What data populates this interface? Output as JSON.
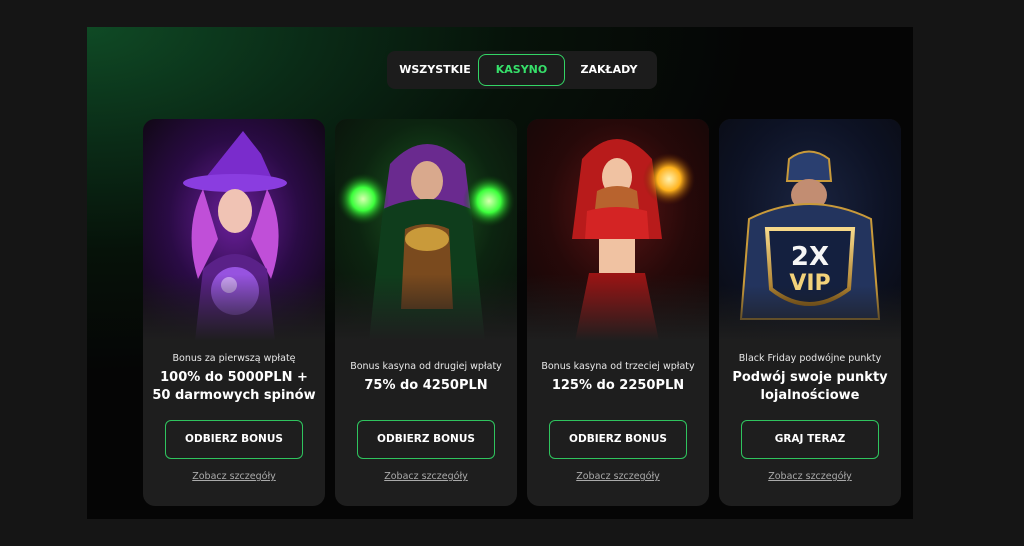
{
  "tabs": [
    {
      "label": "WSZYSTKIE"
    },
    {
      "label": "KASYNO"
    },
    {
      "label": "ZAKŁADY"
    }
  ],
  "accent_color": "#33d465",
  "cards": [
    {
      "subtitle": "Bonus za pierwszą wpłatę",
      "title": "100% do 5000PLN + 50 darmowych spinów",
      "button": "ODBIERZ BONUS",
      "link": "Zobacz szczegóły"
    },
    {
      "subtitle": "Bonus kasyna od drugiej wpłaty",
      "title": "75% do 4250PLN",
      "button": "ODBIERZ BONUS",
      "link": "Zobacz szczegóły"
    },
    {
      "subtitle": "Bonus kasyna od trzeciej wpłaty",
      "title": "125% do 2250PLN",
      "button": "ODBIERZ BONUS",
      "link": "Zobacz szczegóły"
    },
    {
      "subtitle": "Black Friday podwójne punkty",
      "title": "Podwój swoje punkty lojalnościowe",
      "button": "GRAJ TERAZ",
      "link": "Zobacz szczegóły",
      "badge_top": "2X",
      "badge_bottom": "VIP"
    }
  ]
}
